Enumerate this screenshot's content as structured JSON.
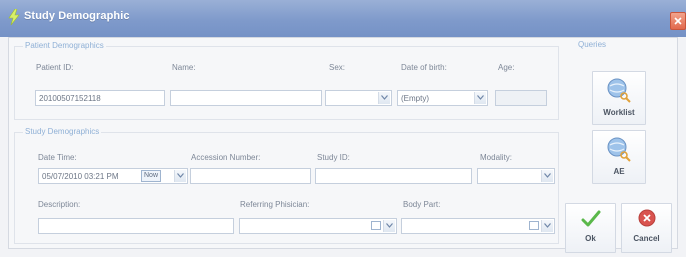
{
  "window": {
    "title": "Study Demographic"
  },
  "patient": {
    "group_title": "Patient Demographics",
    "id_label": "Patient ID:",
    "id_value": "20100507152118",
    "name_label": "Name:",
    "name_value": "",
    "sex_label": "Sex:",
    "sex_value": "",
    "dob_label": "Date of birth:",
    "dob_value": "(Empty)",
    "age_label": "Age:",
    "age_value": ""
  },
  "study": {
    "group_title": "Study Demographics",
    "datetime_label": "Date Time:",
    "datetime_value": "05/07/2010 03:21 PM",
    "now_label": "Now",
    "accession_label": "Accession Number:",
    "accession_value": "",
    "studyid_label": "Study ID:",
    "studyid_value": "",
    "modality_label": "Modality:",
    "modality_value": "",
    "description_label": "Description:",
    "description_value": "",
    "physician_label": "Referring Phisician:",
    "physician_value": "",
    "bodypart_label": "Body Part:",
    "bodypart_value": ""
  },
  "queries": {
    "group_title": "Queries",
    "worklist_label": "Worklist",
    "ae_label": "AE"
  },
  "actions": {
    "ok_label": "Ok",
    "cancel_label": "Cancel"
  },
  "icons": {
    "title": "lightning-icon",
    "close": "close-icon",
    "worklist": "globe-search-icon",
    "ae": "globe-search-icon",
    "ok": "checkmark-icon",
    "cancel": "cancel-icon",
    "dropdown": "chevron-down-icon"
  },
  "colors": {
    "titlebar": "#7f9acb",
    "group_title": "#8fb0d6",
    "close": "#e2694d",
    "ok_check": "#5ab84a",
    "cancel": "#d9534f"
  }
}
